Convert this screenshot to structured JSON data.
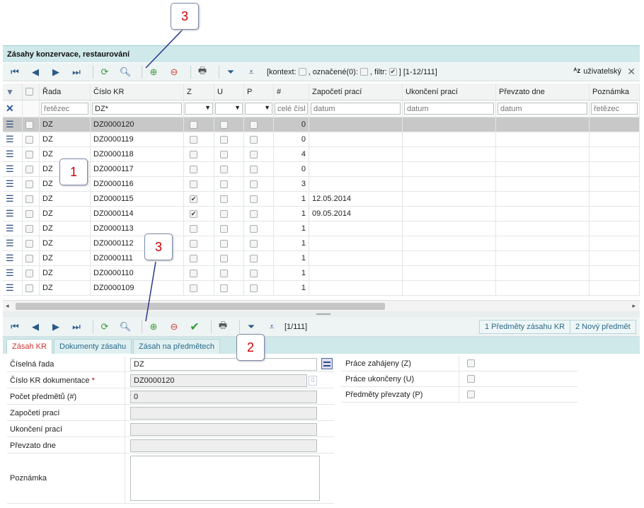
{
  "window": {
    "title": "Zásahy konzervace, restaurování"
  },
  "top_toolbar": {
    "context_text": "[kontext:",
    "marked_text": ", označené(0):",
    "filter_text": ", filtr:",
    "range_text": "] [1-12/111]",
    "user_label": "uživatelský"
  },
  "columns": [
    "Řada",
    "Číslo KR",
    "Z",
    "U",
    "P",
    "#",
    "Započetí prací",
    "Ukončení prací",
    "Převzato dne",
    "Poznámka"
  ],
  "filters": {
    "rada_placeholder": "řetězec",
    "cislo_value": "DZ*",
    "num_placeholder": "celé čísl",
    "date1_placeholder": "datum",
    "date2_placeholder": "datum",
    "date3_placeholder": "datum",
    "note_placeholder": "řetězec"
  },
  "rows": [
    {
      "rada": "DZ",
      "cislo": "DZ0000120",
      "z": false,
      "num": "0",
      "start": ""
    },
    {
      "rada": "DZ",
      "cislo": "DZ0000119",
      "z": false,
      "num": "0",
      "start": ""
    },
    {
      "rada": "DZ",
      "cislo": "DZ0000118",
      "z": false,
      "num": "4",
      "start": ""
    },
    {
      "rada": "DZ",
      "cislo": "DZ0000117",
      "z": false,
      "num": "0",
      "start": ""
    },
    {
      "rada": "DZ",
      "cislo": "DZ0000116",
      "z": false,
      "num": "3",
      "start": ""
    },
    {
      "rada": "DZ",
      "cislo": "DZ0000115",
      "z": true,
      "num": "1",
      "start": "12.05.2014"
    },
    {
      "rada": "DZ",
      "cislo": "DZ0000114",
      "z": true,
      "num": "1",
      "start": "09.05.2014"
    },
    {
      "rada": "DZ",
      "cislo": "DZ0000113",
      "z": false,
      "num": "1",
      "start": ""
    },
    {
      "rada": "DZ",
      "cislo": "DZ0000112",
      "z": false,
      "num": "1",
      "start": ""
    },
    {
      "rada": "DZ",
      "cislo": "DZ0000111",
      "z": false,
      "num": "1",
      "start": ""
    },
    {
      "rada": "DZ",
      "cislo": "DZ0000110",
      "z": false,
      "num": "1",
      "start": ""
    },
    {
      "rada": "DZ",
      "cislo": "DZ0000109",
      "z": false,
      "num": "1",
      "start": ""
    }
  ],
  "bottom_toolbar": {
    "record_text": "[1/111]",
    "btn_items": "1 Předměty zásahu KR",
    "btn_new_item": "2 Nový předmět"
  },
  "tabs": [
    "Zásah KR",
    "Dokumenty zásahu",
    "Zásah na předmětech"
  ],
  "form": {
    "ciselna_rada_label": "Číselná řada",
    "ciselna_rada_value": "DZ",
    "cislo_kr_label": "Číslo KR dokumentace",
    "cislo_kr_value": "DZ0000120",
    "pocet_label": "Počet předmětů (#)",
    "pocet_value": "0",
    "zapoceti_label": "Započetí prací",
    "ukonceni_label": "Ukončení prací",
    "prevzato_label": "Převzato dne",
    "poznamka_label": "Poznámka",
    "zahajeny_label": "Práce zahájeny (Z)",
    "ukonceny_label": "Práce ukončeny (U)",
    "prevzaty_label": "Předměty převzaty (P)"
  },
  "callouts": {
    "c1": "1",
    "c2": "2",
    "c3a": "3",
    "c3b": "3"
  },
  "colors": {
    "accent": "#cfe8ea",
    "selected_row": "#c8c8c8",
    "callout_number": "#cc0000"
  }
}
